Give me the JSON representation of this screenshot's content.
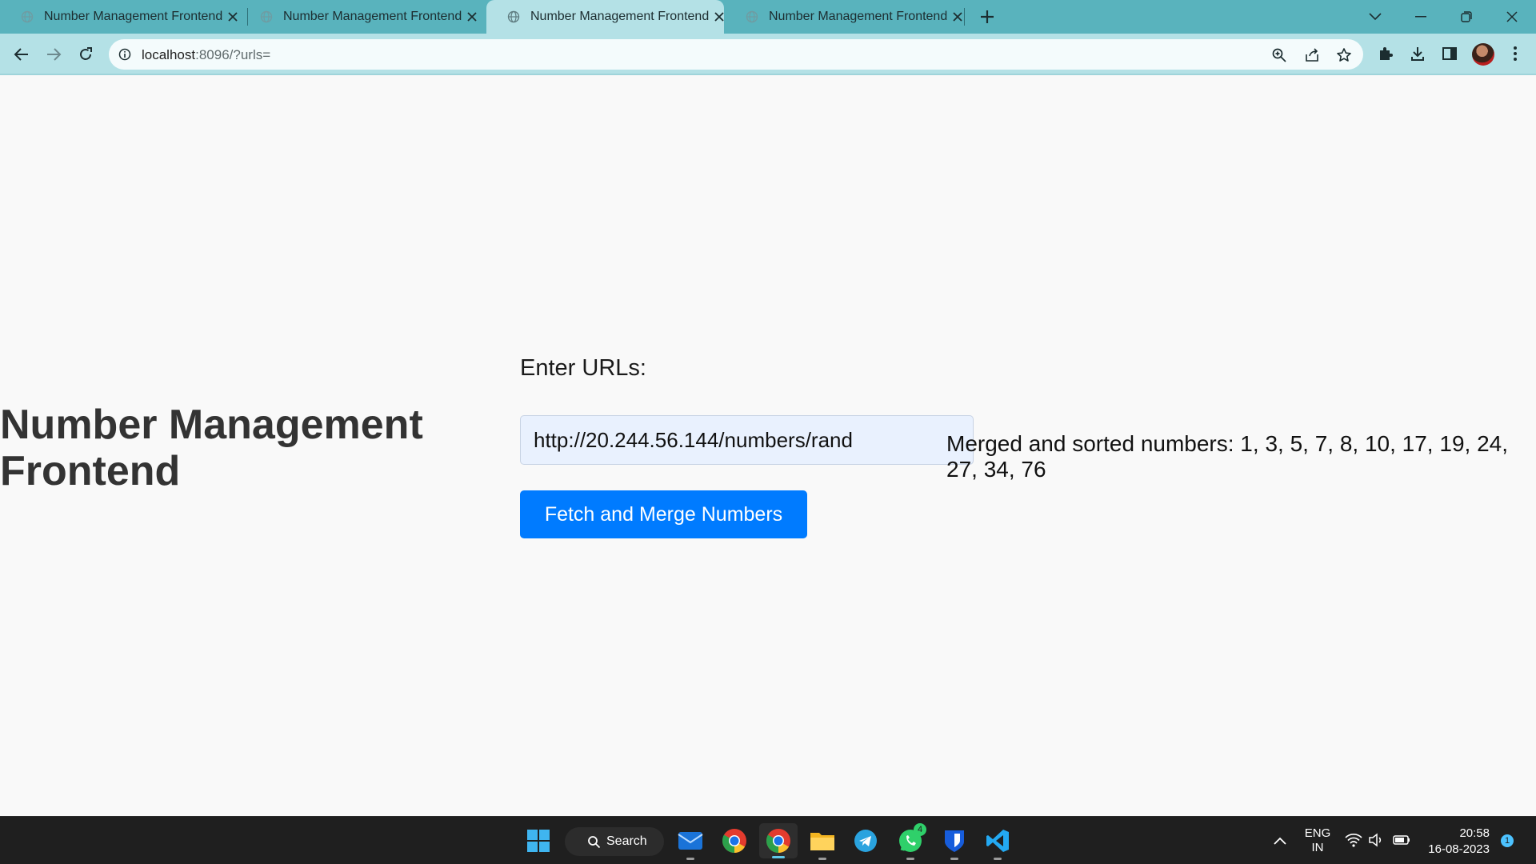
{
  "browser": {
    "tabs": [
      {
        "title": "Number Management Frontend",
        "active": false
      },
      {
        "title": "Number Management Frontend",
        "active": false
      },
      {
        "title": "Number Management Frontend",
        "active": true
      },
      {
        "title": "Number Management Frontend",
        "active": false
      }
    ],
    "address": {
      "host": "localhost",
      "path": ":8096/?urls="
    },
    "icons": [
      "back-icon",
      "forward-icon",
      "reload-icon",
      "site-info-icon",
      "zoom-icon",
      "share-icon",
      "bookmark-star-icon",
      "extensions-icon",
      "download-icon",
      "side-panel-icon",
      "avatar",
      "menu-icon"
    ]
  },
  "page": {
    "heading": "Number Management Frontend",
    "url_label": "Enter URLs:",
    "url_value": "http://20.244.56.144/numbers/rand",
    "button_label": "Fetch and Merge Numbers",
    "result_text": "Merged and sorted numbers: 1, 3, 5, 7, 8, 10, 17, 19, 24, 27, 34, 76"
  },
  "taskbar": {
    "search_label": "Search",
    "apps": [
      "start-icon",
      "mail-icon",
      "chrome-icon",
      "chrome-profile-icon",
      "file-explorer-icon",
      "telegram-icon",
      "whatsapp-icon",
      "bitwarden-icon",
      "vscode-icon"
    ],
    "whatsapp_badge": "4",
    "language": {
      "line1": "ENG",
      "line2": "IN"
    },
    "time": "20:58",
    "date": "16-08-2023",
    "notification_count": "1"
  },
  "colors": {
    "tabstrip": "#59b3bd",
    "toolbar": "#b4e1e6",
    "button": "#007bff",
    "taskbar": "#1f1f1f"
  }
}
